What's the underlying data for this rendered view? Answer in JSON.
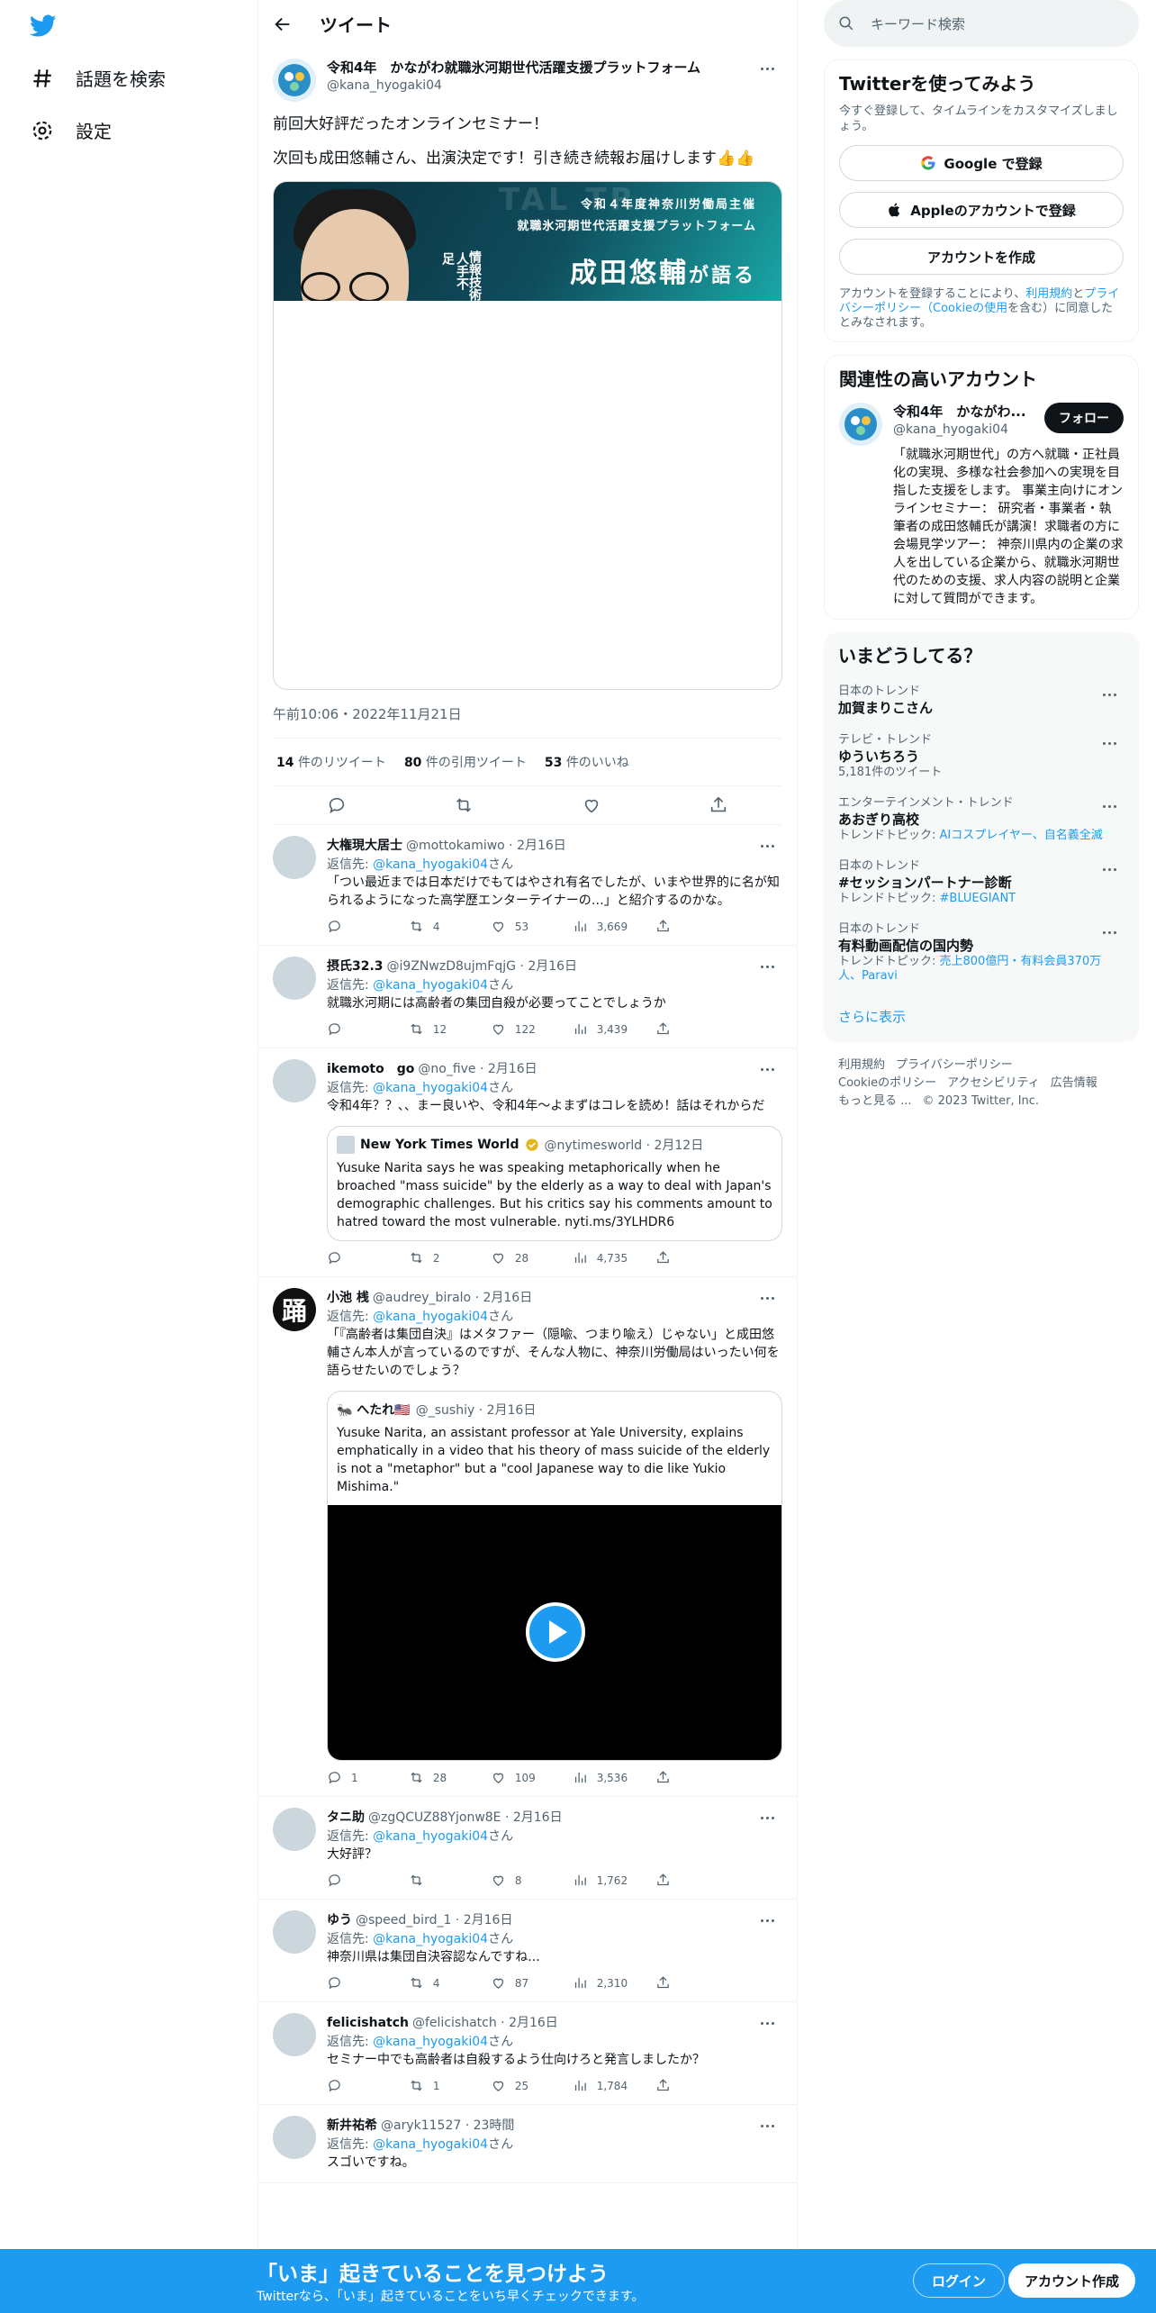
{
  "nav": {
    "explore": "話題を検索",
    "settings": "設定"
  },
  "header": {
    "title": "ツイート"
  },
  "focal": {
    "name": "令和4年　かながわ就職氷河期世代活躍支援プラットフォーム",
    "handle": "@kana_hyogaki04",
    "text1": "前回大好評だったオンラインセミナー！",
    "text2": "次回も成田悠輔さん、出演決定です！引き続き続報お届けします👍👍",
    "banner_line1": "令和４年度神奈川労働局主催",
    "banner_line2": "就職氷河期世代活躍支援プラットフォーム",
    "banner_title": "成田悠輔",
    "banner_title_suffix": "が語る",
    "banner_vert1": "情報技術",
    "banner_vert2": "人手不足",
    "banner_bg": "TAL TR",
    "time": "午前10:06・2022年11月21日",
    "retweets_n": "14",
    "retweets_l": "件のリツイート",
    "quotes_n": "80",
    "quotes_l": "件の引用ツイート",
    "likes_n": "53",
    "likes_l": "件のいいね"
  },
  "replies": [
    {
      "name": "大権現大居士",
      "handle": "@mottokamiwo · 2月16日",
      "to_pre": "返信先: ",
      "to": "@kana_hyogaki04",
      "to_post": "さん",
      "text": "「つい最近までは日本だけでもてはやされ有名でしたが、いまや世界的に名が知られるようになった高学歴エンターテイナーの…」と紹介するのかな。",
      "reply": "",
      "rt": "4",
      "like": "53",
      "views": "3,669"
    },
    {
      "name": "摂氏32.3",
      "handle": "@i9ZNwzD8ujmFqjG · 2月16日",
      "to_pre": "返信先: ",
      "to": "@kana_hyogaki04",
      "to_post": "さん",
      "text": "就職氷河期には高齢者の集団自殺が必要ってことでしょうか",
      "reply": "",
      "rt": "12",
      "like": "122",
      "views": "3,439"
    },
    {
      "name": "ikemoto　go",
      "handle": "@no_five · 2月16日",
      "to_pre": "返信先: ",
      "to": "@kana_hyogaki04",
      "to_post": "さん",
      "text": "令和4年？？、、まー良いや、令和4年〜よまずはコレを読め！話はそれからだ",
      "quote_name": "New York Times World",
      "quote_handle": "@nytimesworld · 2月12日",
      "quote_text": "Yusuke Narita says he was speaking metaphorically when he broached \"mass suicide\" by the elderly as a way to deal with Japan's demographic challenges. But his critics say his comments amount to hatred toward the most vulnerable.",
      "quote_link": "nyti.ms/3YLHDR6",
      "reply": "",
      "rt": "2",
      "like": "28",
      "views": "4,735"
    },
    {
      "name": "小池 桟",
      "handle": "@audrey_biralo · 2月16日",
      "to_pre": "返信先: ",
      "to": "@kana_hyogaki04",
      "to_post": "さん",
      "text": "「『高齢者は集団自決』はメタファー（隠喩、つまり喩え）じゃない」と成田悠輔さん本人が言っているのですが、そんな人物に、神奈川労働局はいったい何を語らせたいのでしょう？",
      "avatar_char": "踊",
      "quote_name": "🐜 へたれ🇺🇸",
      "quote_handle": "@_sushiy · 2月16日",
      "quote_text": "Yusuke Narita, an assistant professor at Yale University, explains emphatically in a video that his theory of mass suicide of the elderly is not a \"metaphor\" but a \"cool Japanese way to die like Yukio Mishima.\"",
      "reply": "1",
      "rt": "28",
      "like": "109",
      "views": "3,536"
    },
    {
      "name": "タニ助",
      "handle": "@zgQCUZ88Yjonw8E · 2月16日",
      "to_pre": "返信先: ",
      "to": "@kana_hyogaki04",
      "to_post": "さん",
      "text": "大好評？",
      "reply": "",
      "rt": "",
      "like": "8",
      "views": "1,762"
    },
    {
      "name": "ゆう",
      "handle": "@speed_bird_1 · 2月16日",
      "to_pre": "返信先: ",
      "to": "@kana_hyogaki04",
      "to_post": "さん",
      "text": "神奈川県は集団自決容認なんですね...",
      "reply": "",
      "rt": "4",
      "like": "87",
      "views": "2,310"
    },
    {
      "name": "felicishatch",
      "handle": "@felicishatch · 2月16日",
      "to_pre": "返信先: ",
      "to": "@kana_hyogaki04",
      "to_post": "さん",
      "text": "セミナー中でも高齢者は自殺するよう仕向けろと発言しましたか？",
      "reply": "",
      "rt": "1",
      "like": "25",
      "views": "1,784"
    },
    {
      "name": "新井祐希",
      "handle": "@aryk11527 · 23時間",
      "to_pre": "返信先: ",
      "to": "@kana_hyogaki04",
      "to_post": "さん",
      "text": "スゴいですね。"
    }
  ],
  "sidebar": {
    "search_placeholder": "キーワード検索",
    "signup_title": "Twitterを使ってみよう",
    "signup_sub": "今すぐ登録して、タイムラインをカスタマイズしましょう。",
    "google": "Google で登録",
    "apple": "Appleのアカウントで登録",
    "create": "アカウントを作成",
    "legal_pre": "アカウントを登録することにより、",
    "legal_terms": "利用規約",
    "legal_and": "と",
    "legal_privacy": "プライバシーポリシー",
    "legal_cookie": "（Cookieの使用",
    "legal_post": "を含む）に同意したとみなされます。",
    "related_title": "関連性の高いアカウント",
    "related_name": "令和4年　かながわ...",
    "related_handle": "@kana_hyogaki04",
    "follow": "フォロー",
    "related_bio": "「就職氷河期世代」の方へ就職・正社員化の実現、多様な社会参加への実現を目指した支援をします。 事業主向けにオンラインセミナー： 研究者・事業者・執筆者の成田悠輔氏が講演！求職者の方に会場見学ツアー： 神奈川県内の企業の求人を出している企業から、就職氷河期世代のための支援、求人内容の説明と企業に対して質問ができます。",
    "trends_title": "いまどうしてる？",
    "trends": [
      {
        "ctx": "日本のトレンド",
        "title": "加賀まりこさん",
        "sub": "",
        "topics": ""
      },
      {
        "ctx": "テレビ・トレンド",
        "title": "ゆういちろう",
        "sub": "5,181件のツイート",
        "topics": ""
      },
      {
        "ctx": "エンターテインメント・トレンド",
        "title": "あおぎり高校",
        "sub": "トレンドトピック: ",
        "topics": "AIコスプレイヤー、自名義全滅"
      },
      {
        "ctx": "日本のトレンド",
        "title": "#セッションパートナー診断",
        "sub": "トレンドトピック: ",
        "topics": "#BLUEGIANT"
      },
      {
        "ctx": "日本のトレンド",
        "title": "有料動画配信の国内勢",
        "sub": "トレンドトピック: ",
        "topics": "売上800億円・有料会員370万人、Paravi"
      }
    ],
    "show_more": "さらに表示",
    "footer1": "利用規約",
    "footer2": "プライバシーポリシー",
    "footer3": "Cookieのポリシー",
    "footer4": "アクセシビリティ",
    "footer5": "広告情報",
    "footer6": "もっと見る ...",
    "footer7": "© 2023 Twitter, Inc."
  },
  "bottom": {
    "title": "「いま」起きていることを見つけよう",
    "sub": "Twitterなら、「いま」起きていることをいち早くチェックできます。",
    "login": "ログイン",
    "signup": "アカウント作成"
  },
  "colors": {
    "accent": "#1d9bf0",
    "text": "#0f1419",
    "muted": "#536471"
  }
}
